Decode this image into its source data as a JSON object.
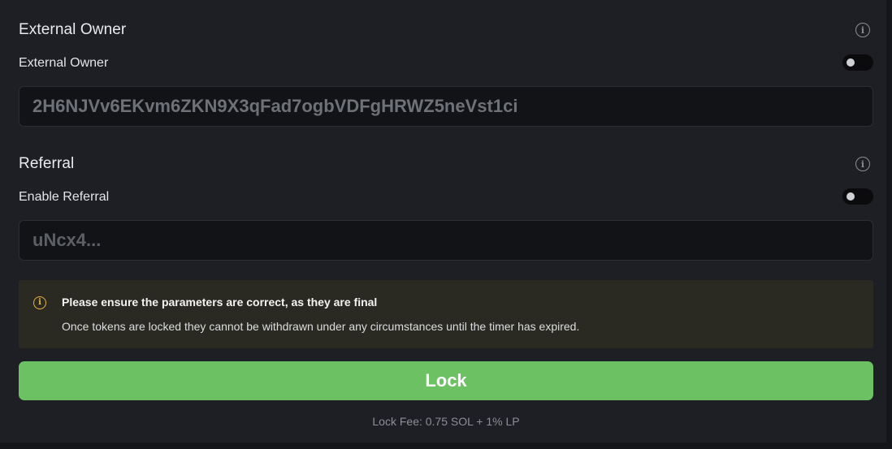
{
  "external_owner": {
    "section_title": "External Owner",
    "toggle_label": "External Owner",
    "toggle_on": false,
    "address_value": "2H6NJVv6EKvm6ZKN9X3qFad7ogbVDFgHRWZ5neVst1ci"
  },
  "referral": {
    "section_title": "Referral",
    "toggle_label": "Enable Referral",
    "toggle_on": false,
    "input_placeholder": "uNcx4..."
  },
  "warning": {
    "title": "Please ensure the parameters are correct, as they are final",
    "message": "Once tokens are locked they cannot be withdrawn under any circumstances until the timer has expired."
  },
  "actions": {
    "lock_label": "Lock",
    "fee_text": "Lock Fee: 0.75 SOL + 1% LP"
  },
  "icons": {
    "info": "info-icon",
    "warning": "warning-info-icon"
  },
  "colors": {
    "primary_button": "#6cc262",
    "warning_accent": "#e8b53e",
    "warning_bg": "#2b2a22"
  }
}
